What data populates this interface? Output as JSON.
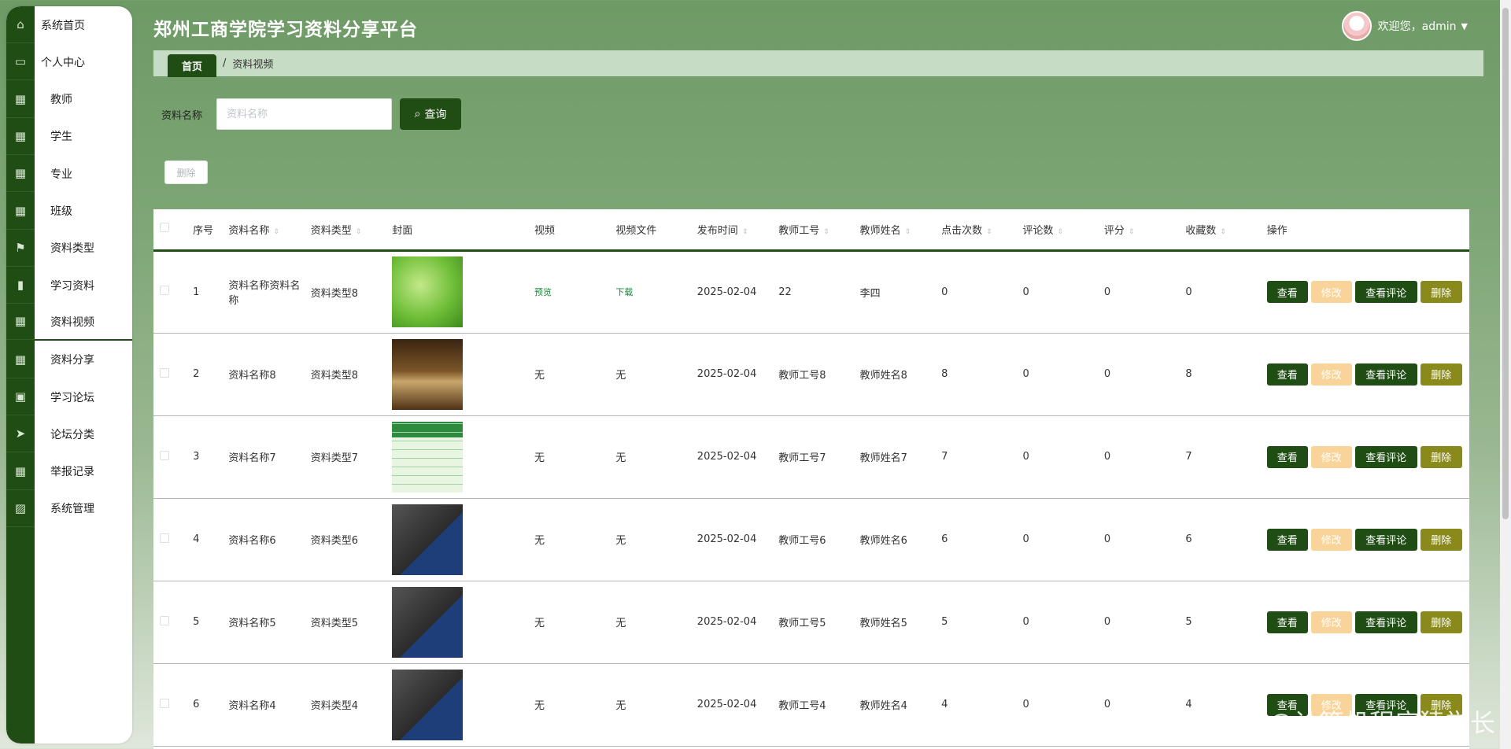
{
  "app": {
    "title": "郑州工商学院学习资料分享平台",
    "welcome": "欢迎您，admin"
  },
  "sidebar": {
    "items": [
      {
        "label": "系统首页",
        "icon": "home-icon",
        "glyph": "⌂"
      },
      {
        "label": "个人中心",
        "icon": "card-icon",
        "glyph": "▭"
      },
      {
        "label": "教师",
        "icon": "grid-icon",
        "glyph": "▦"
      },
      {
        "label": "学生",
        "icon": "grid-icon",
        "glyph": "▦"
      },
      {
        "label": "专业",
        "icon": "grid-icon",
        "glyph": "▦"
      },
      {
        "label": "班级",
        "icon": "grid-icon",
        "glyph": "▦"
      },
      {
        "label": "资料类型",
        "icon": "flag-icon",
        "glyph": "⚑"
      },
      {
        "label": "学习资料",
        "icon": "book-icon",
        "glyph": "▮"
      },
      {
        "label": "资料视频",
        "icon": "grid-icon",
        "glyph": "▦"
      },
      {
        "label": "资料分享",
        "icon": "grid-icon",
        "glyph": "▦"
      },
      {
        "label": "学习论坛",
        "icon": "clipboard-icon",
        "glyph": "▣"
      },
      {
        "label": "论坛分类",
        "icon": "send-icon",
        "glyph": "➤"
      },
      {
        "label": "举报记录",
        "icon": "grid-icon",
        "glyph": "▦"
      },
      {
        "label": "系统管理",
        "icon": "chart-icon",
        "glyph": "▨"
      }
    ]
  },
  "breadcrumb": {
    "home": "首页",
    "current": "资料视频"
  },
  "search": {
    "label": "资料名称",
    "placeholder": "资料名称",
    "value": "",
    "button": "查询"
  },
  "toolbar": {
    "delete_label": "删除"
  },
  "table": {
    "headers": [
      "序号",
      "资料名称",
      "资料类型",
      "封面",
      "视频",
      "视频文件",
      "发布时间",
      "教师工号",
      "教师姓名",
      "点击次数",
      "评论数",
      "评分",
      "收藏数",
      "操作"
    ],
    "ops": {
      "view": "查看",
      "edit": "修改",
      "comments": "查看评论",
      "delete": "删除"
    },
    "rows": [
      {
        "idx": "1",
        "name": "资料名称资料名称",
        "type": "资料类型8",
        "cover": "leaf",
        "video": "预览",
        "file": "下载",
        "date": "2025-02-04",
        "tid": "22",
        "tname": "李四",
        "clicks": "0",
        "comments": "0",
        "score": "0",
        "favs": "0"
      },
      {
        "idx": "2",
        "name": "资料名称8",
        "type": "资料类型8",
        "cover": "book",
        "video": "无",
        "file": "无",
        "date": "2025-02-04",
        "tid": "教师工号8",
        "tname": "教师姓名8",
        "clicks": "8",
        "comments": "0",
        "score": "0",
        "favs": "8"
      },
      {
        "idx": "3",
        "name": "资料名称7",
        "type": "资料类型7",
        "cover": "sched",
        "video": "无",
        "file": "无",
        "date": "2025-02-04",
        "tid": "教师工号7",
        "tname": "教师姓名7",
        "clicks": "7",
        "comments": "0",
        "score": "0",
        "favs": "7"
      },
      {
        "idx": "4",
        "name": "资料名称6",
        "type": "资料类型6",
        "cover": "board",
        "video": "无",
        "file": "无",
        "date": "2025-02-04",
        "tid": "教师工号6",
        "tname": "教师姓名6",
        "clicks": "6",
        "comments": "0",
        "score": "0",
        "favs": "6"
      },
      {
        "idx": "5",
        "name": "资料名称5",
        "type": "资料类型5",
        "cover": "board",
        "video": "无",
        "file": "无",
        "date": "2025-02-04",
        "tid": "教师工号5",
        "tname": "教师姓名5",
        "clicks": "5",
        "comments": "0",
        "score": "0",
        "favs": "5"
      },
      {
        "idx": "6",
        "name": "资料名称4",
        "type": "资料类型4",
        "cover": "board",
        "video": "无",
        "file": "无",
        "date": "2025-02-04",
        "tid": "教师工号4",
        "tname": "教师姓名4",
        "clicks": "4",
        "comments": "0",
        "score": "0",
        "favs": "4"
      }
    ]
  },
  "watermark": "CSDN @计算机程序猿学长",
  "colors": {
    "primary": "#1f4d14",
    "edit": "#f8d49b",
    "delete": "#8a8a1c"
  }
}
